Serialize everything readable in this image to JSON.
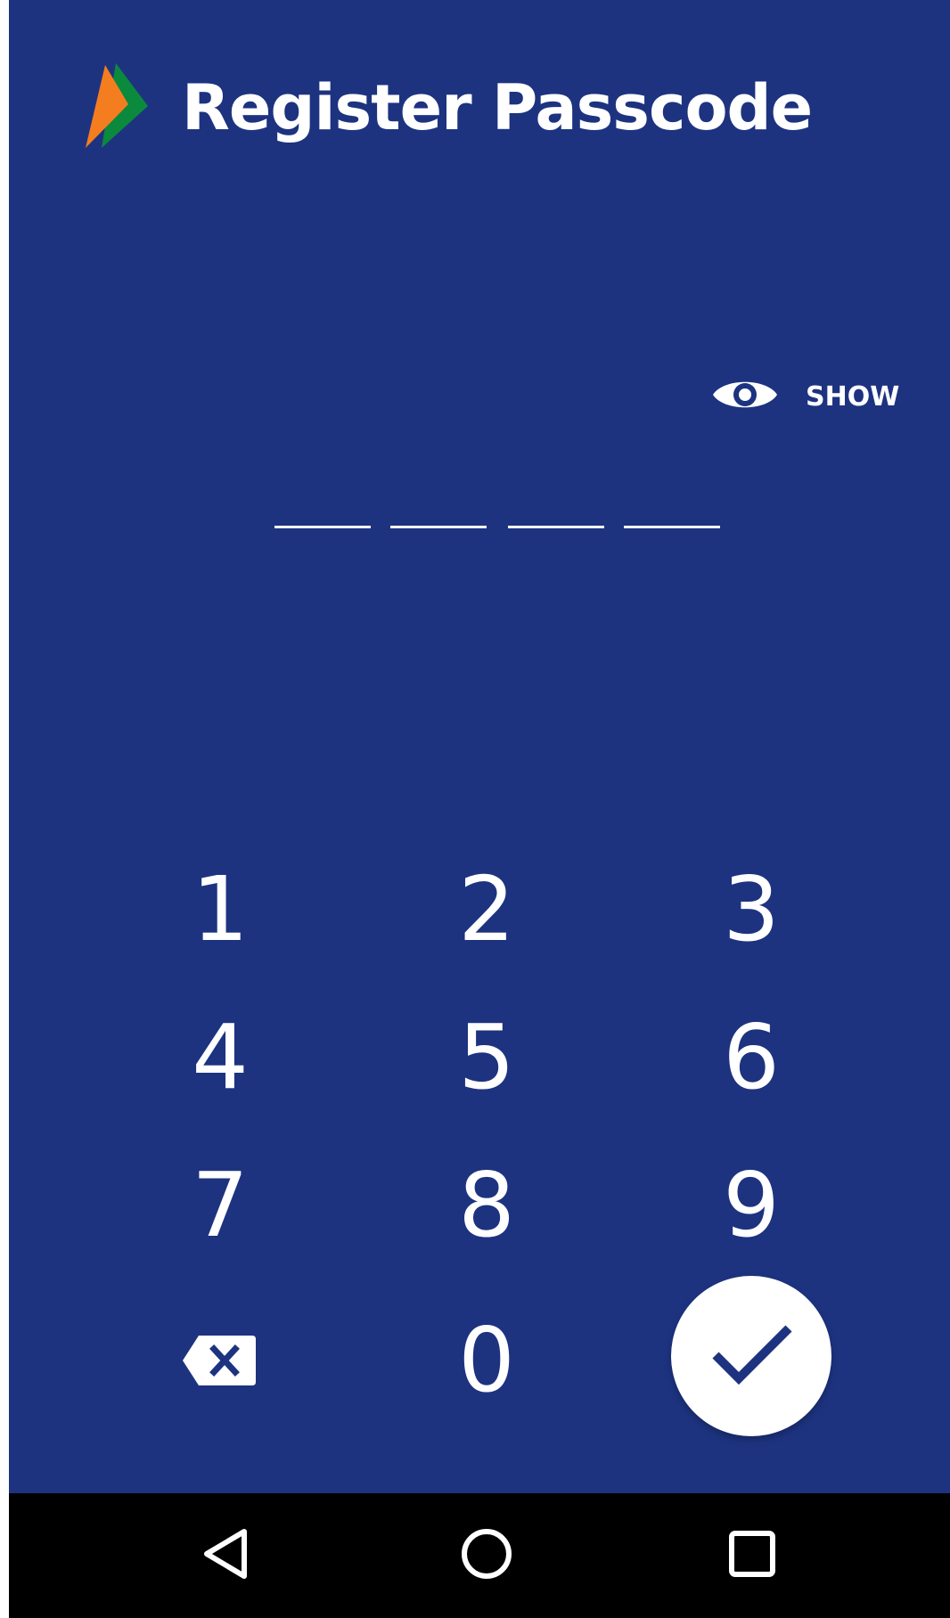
{
  "header": {
    "title": "Register Passcode",
    "logo_colors": {
      "orange": "#f47d20",
      "green": "#0b8a3e"
    }
  },
  "toggle": {
    "show_label": "SHOW",
    "icon": "eye-icon"
  },
  "passcode": {
    "length": 4,
    "entered": ""
  },
  "keypad": {
    "keys": [
      "1",
      "2",
      "3",
      "4",
      "5",
      "6",
      "7",
      "8",
      "9",
      "0"
    ],
    "backspace_icon": "backspace-icon",
    "confirm_icon": "check-icon"
  },
  "navbar": {
    "icons": [
      "back-icon",
      "home-icon",
      "recents-icon"
    ]
  },
  "colors": {
    "background": "#1d3380",
    "text": "#ffffff",
    "navbar": "#000000"
  }
}
